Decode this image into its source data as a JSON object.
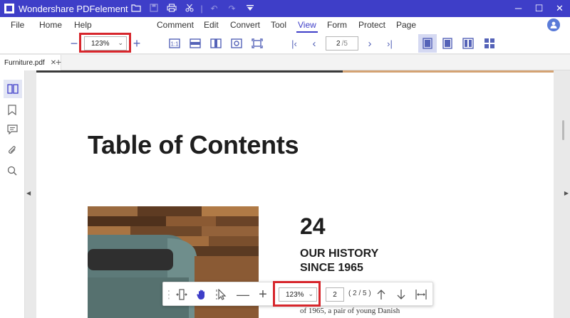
{
  "app": {
    "title": "Wondershare PDFelement",
    "window_controls": {
      "minimize": "─",
      "maximize": "☐",
      "close": "✕"
    }
  },
  "menu": {
    "items": [
      {
        "label": "File"
      },
      {
        "label": "Home"
      },
      {
        "label": "Help"
      },
      {
        "label": "Comment"
      },
      {
        "label": "Edit"
      },
      {
        "label": "Convert"
      },
      {
        "label": "Tool"
      },
      {
        "label": "View",
        "active": true
      },
      {
        "label": "Form"
      },
      {
        "label": "Protect"
      },
      {
        "label": "Page"
      }
    ]
  },
  "toolbar": {
    "zoom_out": "−",
    "zoom_value": "123%",
    "zoom_in": "+",
    "page_current": "2",
    "page_total": "/5",
    "accent": "#3e3ec8",
    "highlight": "#d7262c"
  },
  "tabs": {
    "file_tab": "Furniture.pdf",
    "close": "✕",
    "add": "+"
  },
  "document": {
    "title": "Table of Contents",
    "page_number": "24",
    "heading_line1": "OUR HISTORY",
    "heading_line2": "SINCE 1965",
    "body_text": "of 1965, a pair of young Danish"
  },
  "float_toolbar": {
    "zoom_out": "—",
    "zoom_in": "+",
    "zoom_value": "123%",
    "page_current": "2",
    "page_total": "( 2 / 5 )"
  }
}
